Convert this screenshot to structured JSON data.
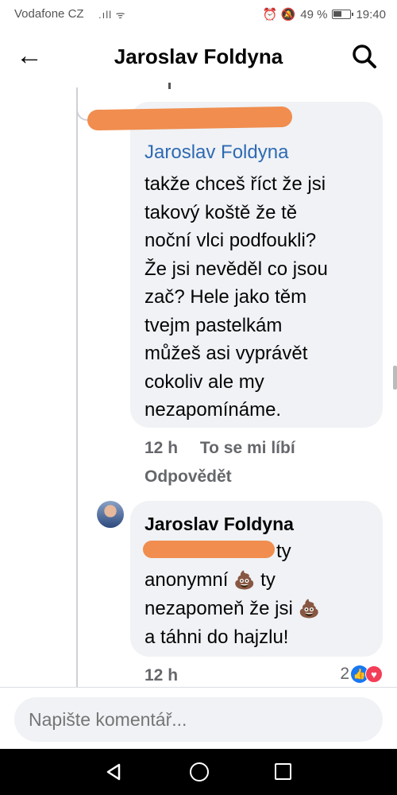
{
  "status_bar": {
    "carrier": "Vodafone CZ",
    "signal": ".ıll ᯤ",
    "alarm_mute": "⏰ 🔕",
    "battery_pct": "49 %",
    "time": "19:40"
  },
  "header": {
    "back_icon": "←",
    "title": "Jaroslav Foldyna",
    "search_icon": "search-icon"
  },
  "comment1": {
    "mention": "Jaroslav Foldyna",
    "lines": [
      "takže chceš říct že jsi",
      "takový koště  že tě",
      "noční vlci podfoukli?",
      "Že jsi nevěděl co jsou",
      "zač? Hele jako těm",
      "tvejm pastelkám",
      "můžeš asi vyprávět",
      "cokoliv ale my",
      "nezapomínáme."
    ],
    "time": "12 h",
    "like": "To se mi líbí",
    "reply": "Odpovědět"
  },
  "comment2": {
    "author": "Jaroslav Foldyna",
    "line1_tail": "ty",
    "line2": "anonymní",
    "line2_tail": "ty",
    "line3": "nezapomeň že jsi",
    "line4": "a táhni do hajzlu!",
    "emoji": "💩",
    "time": "12 h",
    "reaction_count": "2"
  },
  "composer": {
    "placeholder": "Napište komentář..."
  },
  "colors": {
    "link_blue": "#2e6ab3",
    "bubble_bg": "#f0f2f5",
    "redaction": "#f08d4f",
    "meta_gray": "#65676b"
  }
}
